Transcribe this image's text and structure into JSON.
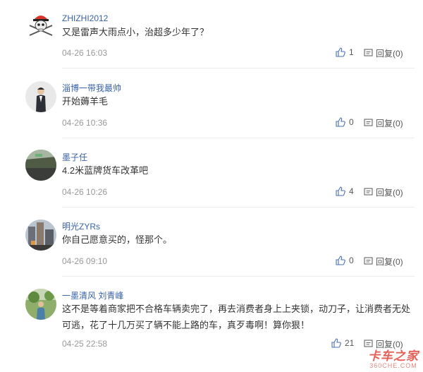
{
  "comments": [
    {
      "username": "ZHIZHI2012",
      "content": "又是雷声大雨点小，治超多少年了？",
      "time": "04-26 16:03",
      "likes": "1",
      "reply_label": "回复(0)",
      "avatar_icon": "pirate-skull-icon"
    },
    {
      "username": "淄博一带我最帅",
      "content": "开始薅羊毛",
      "time": "04-26 10:36",
      "likes": "0",
      "reply_label": "回复(0)",
      "avatar_icon": "suited-man-icon"
    },
    {
      "username": "墨子任",
      "content": "4.2米蓝牌货车改革吧",
      "time": "04-26 10:26",
      "likes": "4",
      "reply_label": "回复(0)",
      "avatar_icon": "landscape-photo-icon"
    },
    {
      "username": "明光ZYRs",
      "content": "你自己愿意买的，怪那个。",
      "time": "04-26 09:10",
      "likes": "0",
      "reply_label": "回复(0)",
      "avatar_icon": "city-photo-icon"
    },
    {
      "username": "一墨清风 刘青峰",
      "content_lines": [
        "这不是等着商家把不合格车辆卖完了，再去消费者身上上夹锁，动刀子，让消费者无处",
        "可逃，花了十几万买了辆不能上路的车，真歹毒啊！算你狠！"
      ],
      "time": "04-25 22:58",
      "likes": "21",
      "reply_label": "回复(0)",
      "avatar_icon": "person-outdoors-icon"
    }
  ],
  "watermark": {
    "main": "卡车之家",
    "sub": "360CHE.COM"
  },
  "colors": {
    "username": "#3a62a8",
    "text": "#333333",
    "meta": "#999999",
    "watermark": "#e0453a"
  }
}
